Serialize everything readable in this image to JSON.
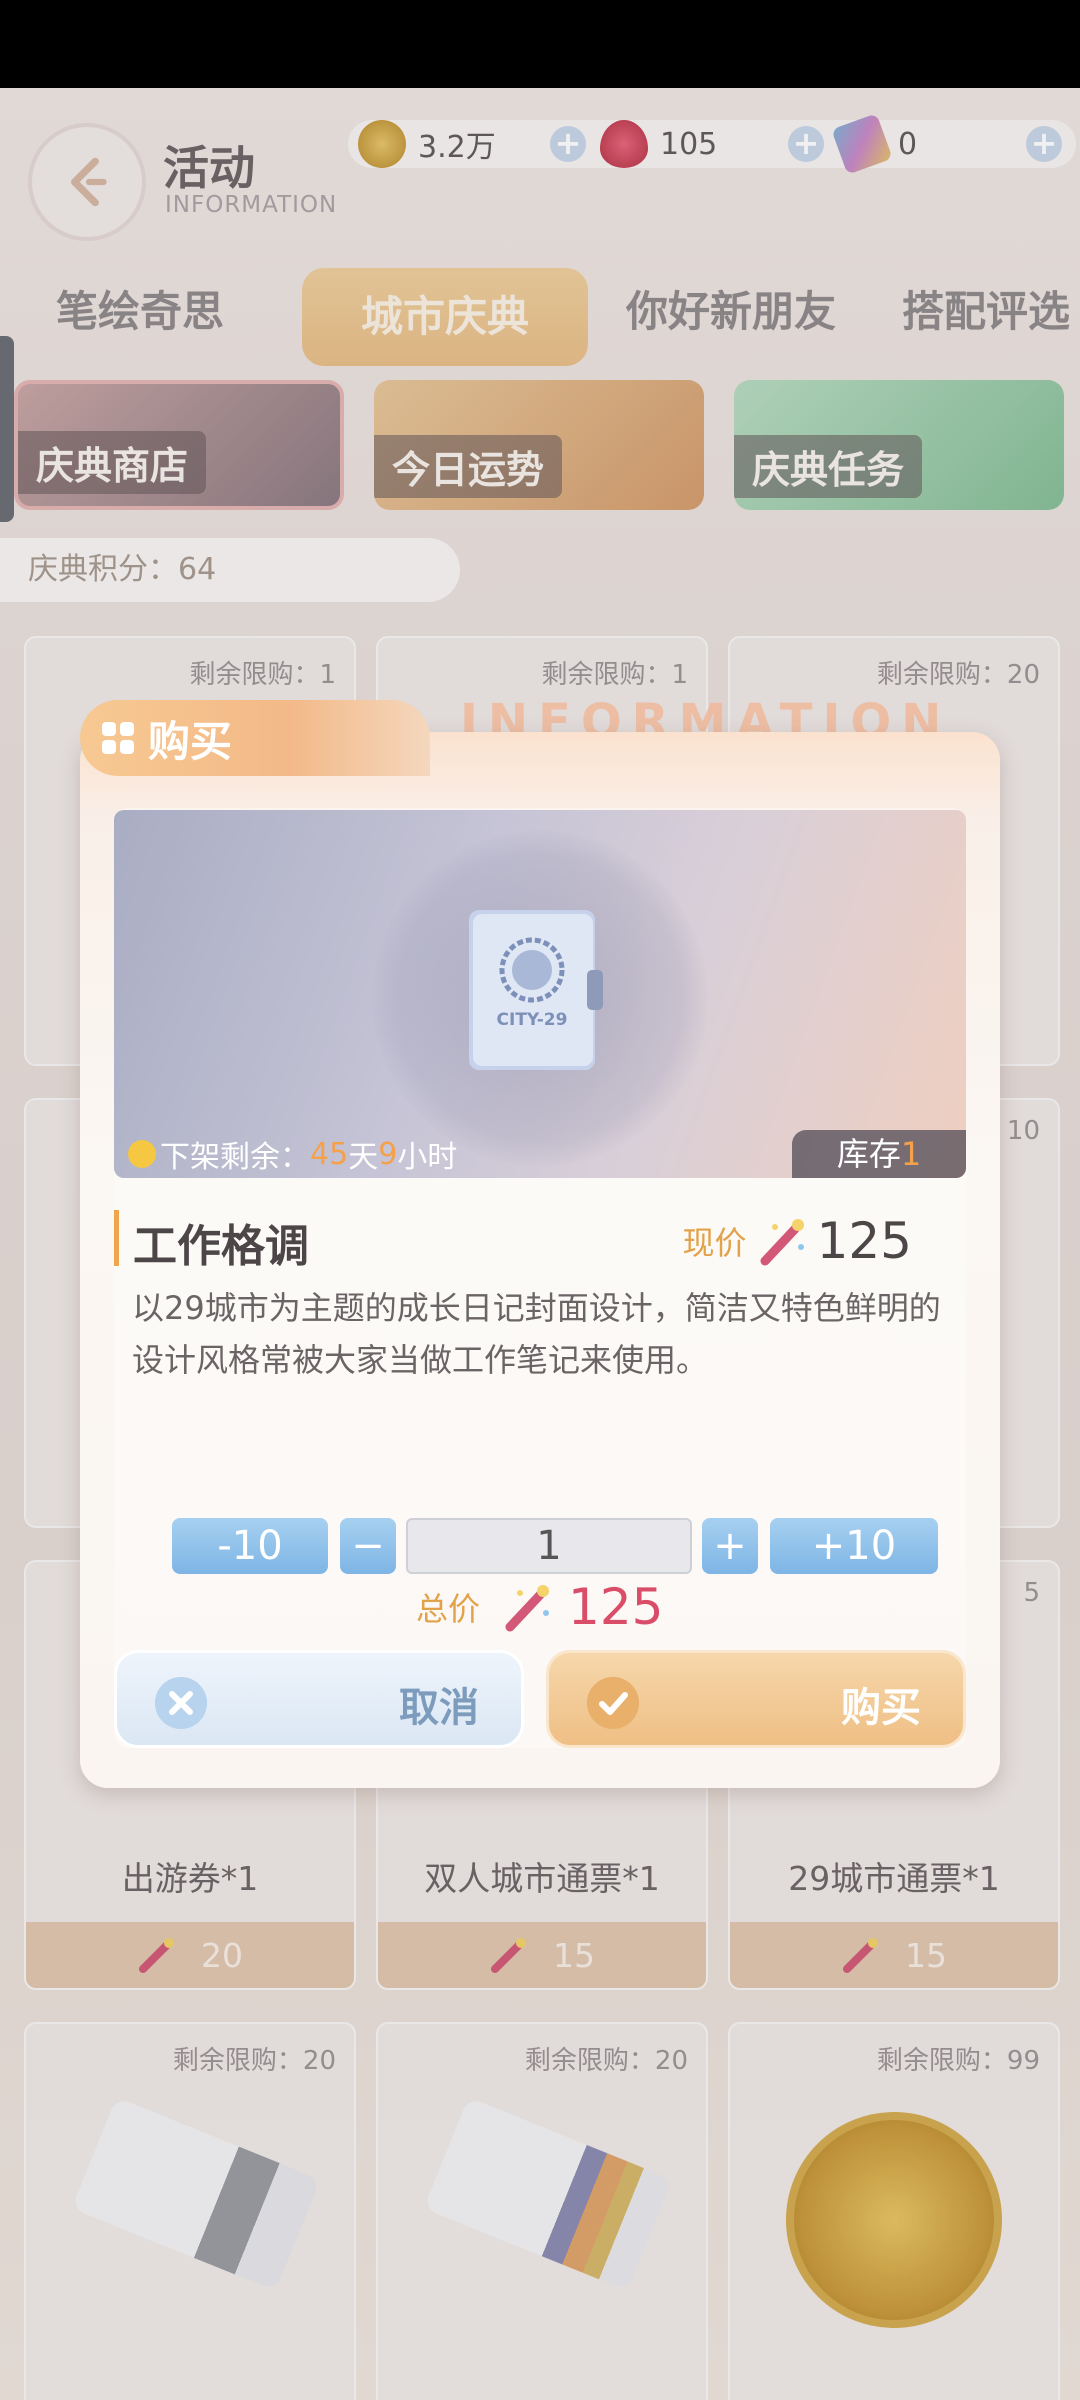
{
  "header": {
    "title": "活动",
    "subtitle": "INFORMATION",
    "resources": [
      {
        "icon": "gold-coin-icon",
        "value": "3.2万"
      },
      {
        "icon": "red-gem-icon",
        "value": "105"
      },
      {
        "icon": "card-ticket-icon",
        "value": "0"
      }
    ],
    "plus_label": "+"
  },
  "tabs": [
    {
      "label": "笔绘奇思"
    },
    {
      "label": "城市庆典"
    },
    {
      "label": "你好新朋友"
    },
    {
      "label": "搭配评选"
    }
  ],
  "banners": [
    {
      "label": "庆典商店"
    },
    {
      "label": "今日运势"
    },
    {
      "label": "庆典任务"
    }
  ],
  "points": "庆典积分：64",
  "shop": {
    "row1": [
      {
        "limit": "剩余限购：1"
      },
      {
        "limit": "剩余限购：1"
      },
      {
        "limit": "剩余限购：20"
      }
    ],
    "row3": [
      {
        "name": "出游券*1",
        "price": "20",
        "limit": ""
      },
      {
        "name": "双人城市通票*1",
        "price": "15",
        "limit": ""
      },
      {
        "name": "29城市通票*1",
        "price": "15",
        "limit": "5"
      }
    ],
    "row2_limit": "10",
    "row4": [
      {
        "limit": "剩余限购：20"
      },
      {
        "limit": "剩余限购：20"
      },
      {
        "limit": "剩余限购：99"
      }
    ]
  },
  "modal": {
    "tab_label": "购买",
    "deco_text": "INFORMATION",
    "book_text": "CITY-29",
    "timer_prefix": "下架剩余：",
    "timer_days": "45",
    "timer_days_unit": "天",
    "timer_hours": "9",
    "timer_hours_unit": "小时",
    "stock_label": "库存",
    "stock_value": "1",
    "item_name": "工作格调",
    "price_label": "现价",
    "price_value": "125",
    "description": "以29城市为主题的成长日记封面设计，简洁又特色鲜明的设计风格常被大家当做工作笔记来使用。",
    "qty_minus10": "-10",
    "qty_minus": "−",
    "qty_value": "1",
    "qty_plus": "+",
    "qty_plus10": "+10",
    "total_label": "总价",
    "total_value": "125",
    "cancel_label": "取消",
    "buy_label": "购买"
  },
  "colors": {
    "accent_orange": "#f0a44c",
    "price_red": "#d94d68",
    "blue_button": "#7eb5e5"
  }
}
